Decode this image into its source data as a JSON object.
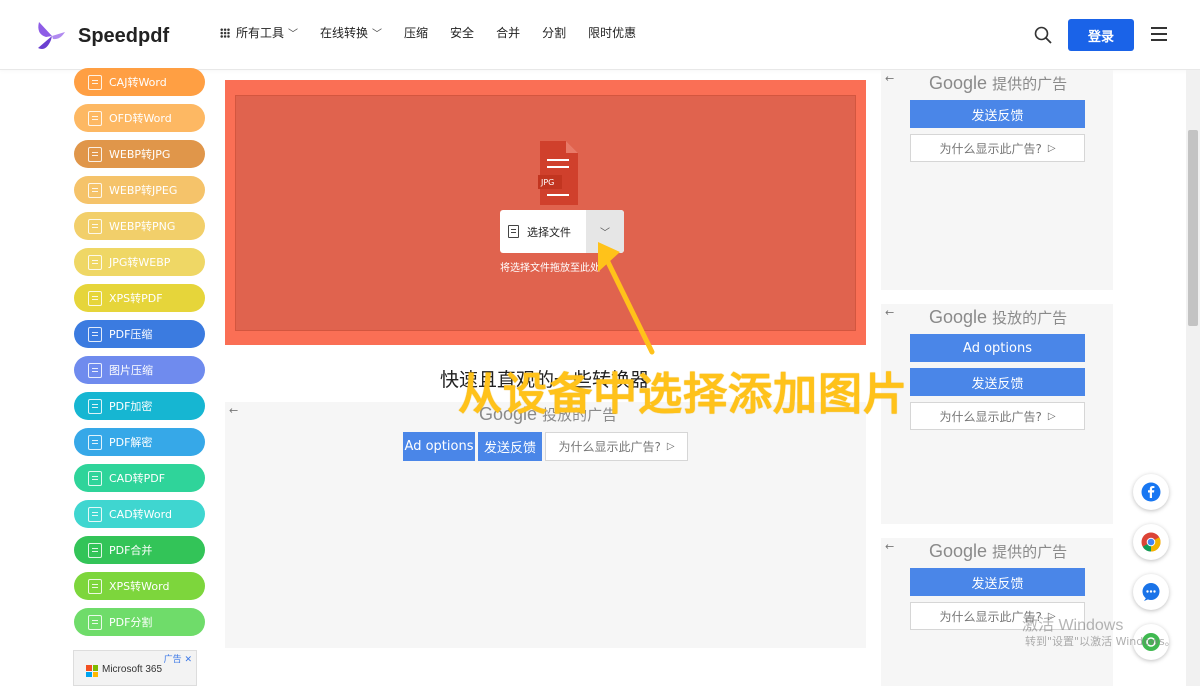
{
  "header": {
    "logo_text": "Speedpdf",
    "nav": [
      {
        "label": "所有工具",
        "has_dropdown": true
      },
      {
        "label": "在线转换",
        "has_dropdown": true
      },
      {
        "label": "压缩",
        "has_dropdown": false
      },
      {
        "label": "安全",
        "has_dropdown": false
      },
      {
        "label": "合并",
        "has_dropdown": false
      },
      {
        "label": "分割",
        "has_dropdown": false
      },
      {
        "label": "限时优惠",
        "has_dropdown": false
      }
    ],
    "login_label": "登录",
    "icons": [
      "grid-icon",
      "search-icon",
      "menu-icon"
    ]
  },
  "sidebar": {
    "items": [
      {
        "label": "CAJ转Word",
        "color": "#ff9f43"
      },
      {
        "label": "OFD转Word",
        "color": "#fdb863"
      },
      {
        "label": "WEBP转JPG",
        "color": "#e0964a"
      },
      {
        "label": "WEBP转JPEG",
        "color": "#f5c36a"
      },
      {
        "label": "WEBP转PNG",
        "color": "#f2cf6a"
      },
      {
        "label": "JPG转WEBP",
        "color": "#efd765"
      },
      {
        "label": "XPS转PDF",
        "color": "#e6d53a"
      },
      {
        "label": "PDF压缩",
        "color": "#3b7be0"
      },
      {
        "label": "图片压缩",
        "color": "#6f8bee"
      },
      {
        "label": "PDF加密",
        "color": "#16b6d2"
      },
      {
        "label": "PDF解密",
        "color": "#36a8e8"
      },
      {
        "label": "CAD转PDF",
        "color": "#2fd49a"
      },
      {
        "label": "CAD转Word",
        "color": "#3fd6d0"
      },
      {
        "label": "PDF合并",
        "color": "#33c458"
      },
      {
        "label": "XPS转Word",
        "color": "#7dd63c"
      },
      {
        "label": "PDF分割",
        "color": "#6fdc6a"
      }
    ],
    "ms_ad": {
      "text": "Microsoft 365",
      "tag": "广告"
    }
  },
  "upload": {
    "file_type": "JPG",
    "select_label": "选择文件",
    "drop_hint": "将选择文件拖放至此处",
    "accent": "#fa6f55",
    "icon_color": "#d0402c"
  },
  "subtitle": "快速且直观的一些转换器",
  "center_ad": {
    "google_word": "Google",
    "label_suffix": "投放的广告",
    "ad_options": "Ad options",
    "feedback": "发送反馈",
    "why": "为什么显示此广告?"
  },
  "right_ads": [
    {
      "google_word": "Google",
      "label_suffix": "提供的广告",
      "feedback": "发送反馈",
      "why": "为什么显示此广告?"
    },
    {
      "google_word": "Google",
      "label_suffix": "投放的广告",
      "ad_options": "Ad options",
      "feedback": "发送反馈",
      "why": "为什么显示此广告?"
    },
    {
      "google_word": "Google",
      "label_suffix": "提供的广告",
      "feedback": "发送反馈",
      "why": "为什么显示此广告?"
    }
  ],
  "floating": [
    "facebook-icon",
    "chrome-icon",
    "chat-icon",
    "share-icon"
  ],
  "annotation": {
    "text": "从设备中选择添加图片",
    "color": "#ffc21a"
  },
  "watermark": {
    "line1": "激活 Windows",
    "line2": "转到\"设置\"以激活 Windows。"
  }
}
